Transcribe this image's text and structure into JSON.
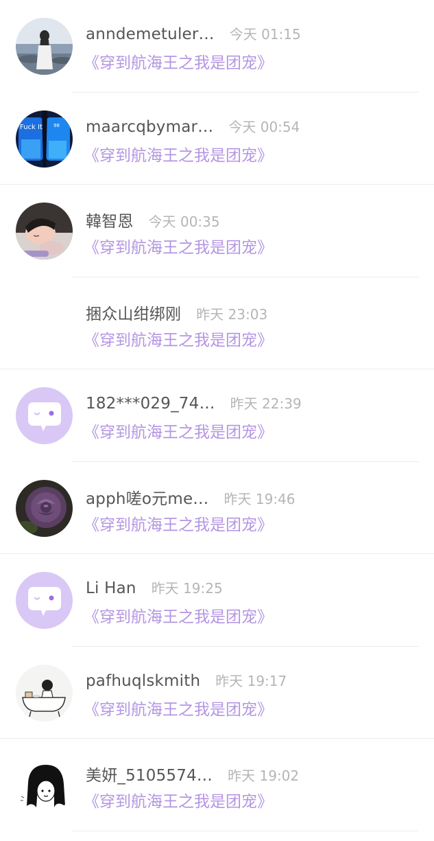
{
  "list": {
    "items": [
      {
        "name": "anndemetuler…",
        "time": "今天 01:15",
        "book": "《穿到航海王之我是团宠》",
        "avatar": "photo-girl-seaside"
      },
      {
        "name": "maarcqbymar…",
        "time": "今天 00:54",
        "book": "《穿到航海王之我是团宠》",
        "avatar": "photo-neon-sign"
      },
      {
        "name": "韓智恩",
        "time": "今天 00:35",
        "book": "《穿到航海王之我是团宠》",
        "avatar": "photo-sleeping-child"
      },
      {
        "name": "捆众山绀绑刚",
        "time": "昨天 23:03",
        "book": "《穿到航海王之我是团宠》",
        "avatar": "none"
      },
      {
        "name": "182***029_74…",
        "time": "昨天 22:39",
        "book": "《穿到航海王之我是团宠》",
        "avatar": "default-chat-bubble"
      },
      {
        "name": "apph嗟o元me…",
        "time": "昨天 19:46",
        "book": "《穿到航海王之我是团宠》",
        "avatar": "photo-purple-rose"
      },
      {
        "name": "Li Han",
        "time": "昨天 19:25",
        "book": "《穿到航海王之我是团宠》",
        "avatar": "default-chat-bubble"
      },
      {
        "name": "pafhuqlskmith",
        "time": "昨天 19:17",
        "book": "《穿到航海王之我是团宠》",
        "avatar": "sketch-bathtub"
      },
      {
        "name": "美妍_5105574…",
        "time": "昨天 19:02",
        "book": "《穿到航海王之我是团宠》",
        "avatar": "sketch-black-hair-girl"
      }
    ]
  },
  "colors": {
    "name": "#555555",
    "time": "#b5b5b5",
    "book_title": "#b495e2",
    "default_avatar_bg": "#d9c8f5",
    "divider": "#ededed"
  }
}
